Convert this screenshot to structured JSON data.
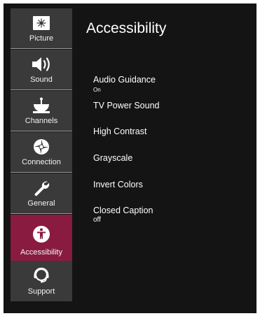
{
  "sidebar": {
    "items": [
      {
        "label": "Picture",
        "icon": "picture-icon"
      },
      {
        "label": "Sound",
        "icon": "speaker-icon"
      },
      {
        "label": "Channels",
        "icon": "satellite-dish-icon"
      },
      {
        "label": "Connection",
        "icon": "network-icon"
      },
      {
        "label": "General",
        "icon": "wrench-icon"
      },
      {
        "label": "Accessibility",
        "icon": "accessibility-icon",
        "active": true
      },
      {
        "label": "Support",
        "icon": "headset-icon"
      }
    ]
  },
  "main": {
    "title": "Accessibility",
    "items": [
      {
        "label": "Audio Guidance",
        "value": "On"
      },
      {
        "label": "TV Power Sound"
      },
      {
        "label": "High Contrast"
      },
      {
        "label": "Grayscale"
      },
      {
        "label": "Invert Colors"
      },
      {
        "label": "Closed Caption",
        "value": "off"
      }
    ]
  },
  "colors": {
    "background": "#141414",
    "sidebar_item": "#3a3a3a",
    "active_item": "#8a1b40",
    "text": "#ffffff"
  }
}
